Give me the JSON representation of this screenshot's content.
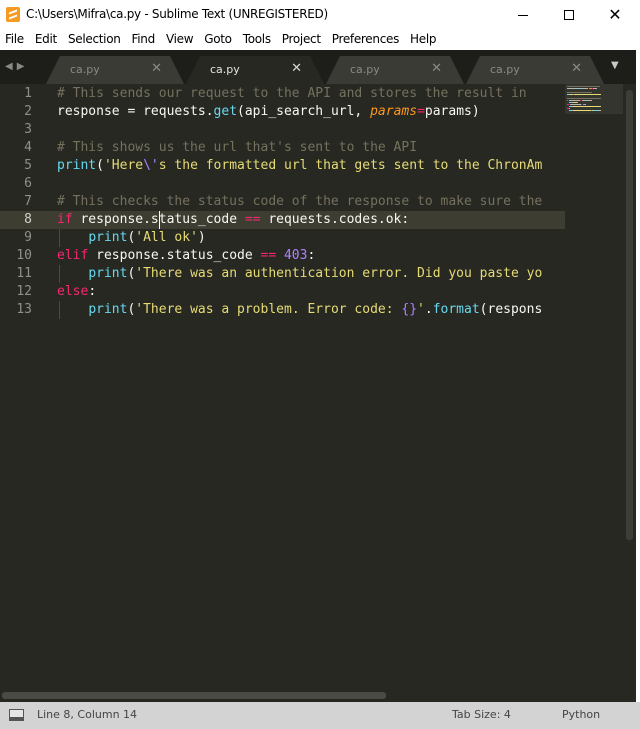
{
  "window": {
    "title": "C:\\Users\\Mifra\\ca.py - Sublime Text (UNREGISTERED)",
    "close_glyph": "✕"
  },
  "menu": [
    "File",
    "Edit",
    "Selection",
    "Find",
    "View",
    "Goto",
    "Tools",
    "Project",
    "Preferences",
    "Help"
  ],
  "tabbar": {
    "nav_glyphs": "◀▶",
    "dropdown_glyph": "▼",
    "tabs": [
      {
        "label": "ca.py",
        "active": false
      },
      {
        "label": "ca.py",
        "active": true
      },
      {
        "label": "ca.py",
        "active": false
      },
      {
        "label": "ca.py",
        "active": false
      }
    ],
    "close_glyph": "✕"
  },
  "editor": {
    "current_line": 8,
    "lines": [
      {
        "n": "1",
        "tokens": [
          [
            "c-comment",
            "# This sends our request to the API and stores the result in "
          ]
        ]
      },
      {
        "n": "2",
        "tokens": [
          [
            "c-plain",
            "response = requests."
          ],
          [
            "c-fn",
            "get"
          ],
          [
            "c-plain",
            "(api_search_url, "
          ],
          [
            "c-param",
            "params"
          ],
          [
            "c-kw",
            "="
          ],
          [
            "c-plain",
            "params)"
          ]
        ]
      },
      {
        "n": "3",
        "tokens": []
      },
      {
        "n": "4",
        "tokens": [
          [
            "c-comment",
            "# This shows us the url that's sent to the API"
          ]
        ]
      },
      {
        "n": "5",
        "tokens": [
          [
            "c-fn",
            "print"
          ],
          [
            "c-plain",
            "("
          ],
          [
            "c-str",
            "'Here"
          ],
          [
            "c-esc",
            "\\'"
          ],
          [
            "c-str",
            "s the formatted url that gets sent to the ChronAm"
          ]
        ]
      },
      {
        "n": "6",
        "tokens": []
      },
      {
        "n": "7",
        "tokens": [
          [
            "c-comment",
            "# This checks the status code of the response to make sure the"
          ]
        ]
      },
      {
        "n": "8",
        "tokens": [
          [
            "c-kw",
            "if"
          ],
          [
            "c-plain",
            " response.status_code "
          ],
          [
            "c-kw",
            "=="
          ],
          [
            "c-plain",
            " requests.codes.ok:"
          ]
        ]
      },
      {
        "n": "9",
        "tokens": [
          [
            "c-plain",
            "    "
          ],
          [
            "c-fn",
            "print"
          ],
          [
            "c-plain",
            "("
          ],
          [
            "c-str",
            "'All ok'"
          ],
          [
            "c-plain",
            ")"
          ]
        ]
      },
      {
        "n": "10",
        "tokens": [
          [
            "c-kw",
            "elif"
          ],
          [
            "c-plain",
            " response.status_code "
          ],
          [
            "c-kw",
            "=="
          ],
          [
            "c-plain",
            " "
          ],
          [
            "c-num",
            "403"
          ],
          [
            "c-plain",
            ":"
          ]
        ]
      },
      {
        "n": "11",
        "tokens": [
          [
            "c-plain",
            "    "
          ],
          [
            "c-fn",
            "print"
          ],
          [
            "c-plain",
            "("
          ],
          [
            "c-str",
            "'There was an authentication error. Did you paste yo"
          ]
        ]
      },
      {
        "n": "12",
        "tokens": [
          [
            "c-kw",
            "else"
          ],
          [
            "c-plain",
            ":"
          ]
        ]
      },
      {
        "n": "13",
        "tokens": [
          [
            "c-plain",
            "    "
          ],
          [
            "c-fn",
            "print"
          ],
          [
            "c-plain",
            "("
          ],
          [
            "c-str",
            "'There was a problem. Error code: "
          ],
          [
            "c-num",
            "{}"
          ],
          [
            "c-str",
            "'"
          ],
          [
            "c-plain",
            "."
          ],
          [
            "c-fn",
            "format"
          ],
          [
            "c-plain",
            "(respons"
          ]
        ]
      }
    ]
  },
  "status": {
    "position": "Line 8, Column 14",
    "tab_size": "Tab Size: 4",
    "syntax": "Python"
  },
  "colors": {
    "editor_bg": "#272822",
    "comment": "#75715e",
    "keyword": "#f92672",
    "string": "#e6db74",
    "function": "#66d9ef",
    "number": "#ae81ff",
    "parameter": "#fd971f"
  }
}
